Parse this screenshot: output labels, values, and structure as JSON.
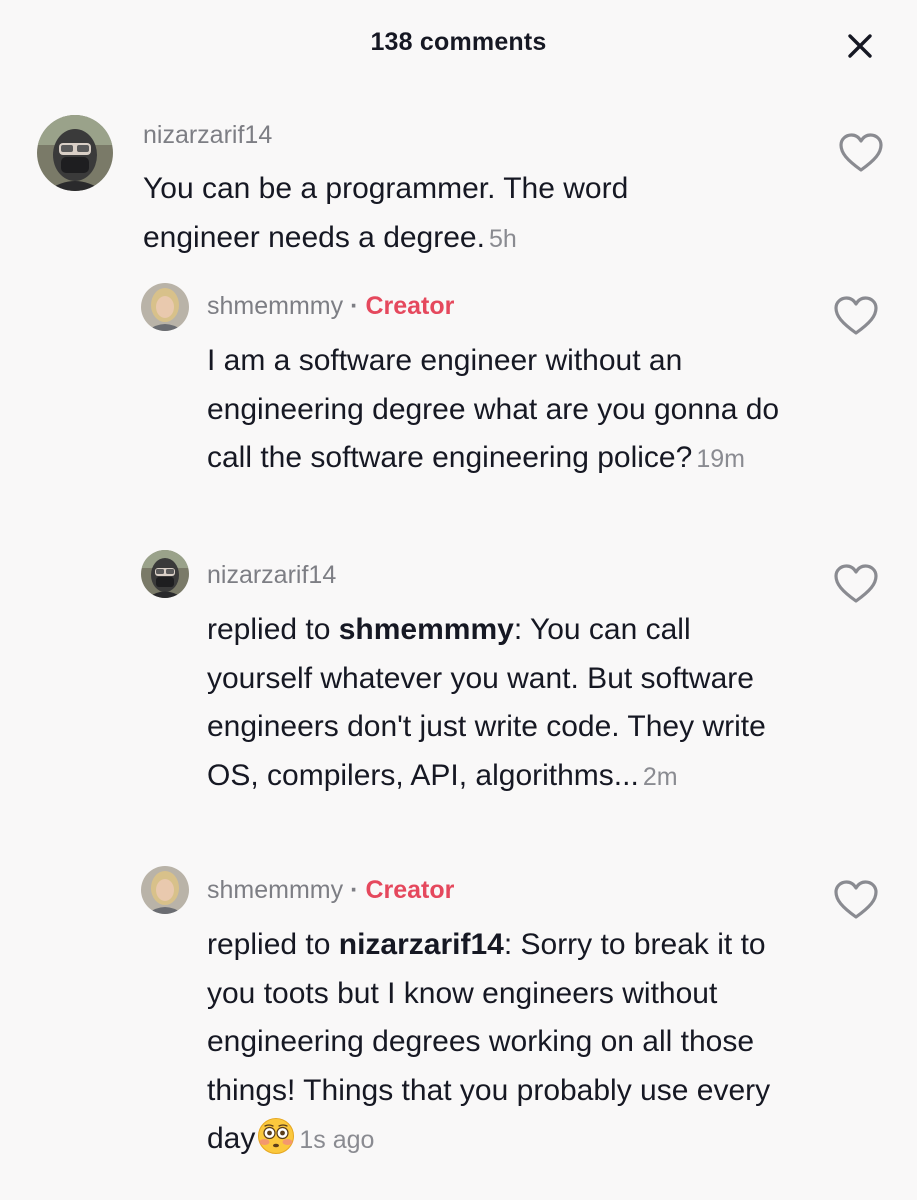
{
  "header": {
    "title": "138 comments",
    "close_icon": "close-icon"
  },
  "comments": [
    {
      "username": "nizarzarif14",
      "text": "You can be a programmer. The word engineer needs a degree.",
      "timestamp": "5h",
      "like_icon": "heart-outline-icon"
    },
    {
      "username": "shmemmmy",
      "badge": "Creator",
      "text": "I am a software engineer without an engineering degree what are you gonna do call the software engineering police?",
      "timestamp": "19m",
      "like_icon": "heart-outline-icon"
    },
    {
      "username": "nizarzarif14",
      "reply_prefix": "replied to ",
      "reply_to": "shmemmmy",
      "text": ": You can call yourself whatever you want. But software engineers don't just write code. They write OS, compilers, API, algorithms...",
      "timestamp": "2m",
      "like_icon": "heart-outline-icon"
    },
    {
      "username": "shmemmmy",
      "badge": "Creator",
      "reply_prefix": "replied to ",
      "reply_to": "nizarzarif14",
      "text": ": Sorry to break it to you toots but I know engineers without engineering degrees working on all those things! Things that you probably use every day",
      "emoji": "flushed-face-emoji",
      "timestamp": "1s ago",
      "like_icon": "heart-outline-icon"
    }
  ],
  "colors": {
    "background": "#f9f8f8",
    "text": "#161823",
    "muted": "#7d7e84",
    "creator_badge": "#e5485d"
  }
}
